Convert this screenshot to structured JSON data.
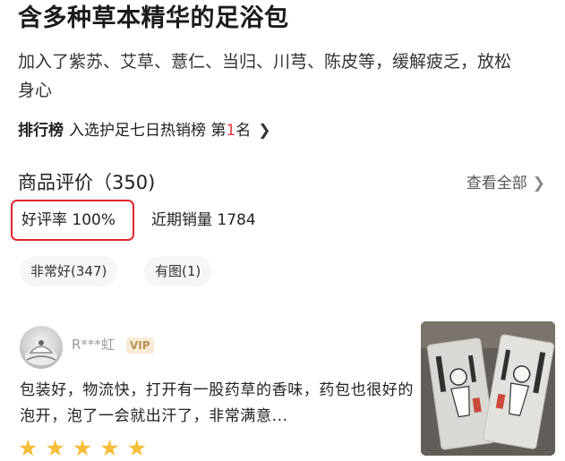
{
  "product": {
    "title": "含多种草本精华的足浴包",
    "description": "加入了紫苏、艾草、薏仁、当归、川芎、陈皮等，缓解疲乏，放松身心"
  },
  "ranking": {
    "tag": "排行榜",
    "text_prefix": "入选护足七日热销榜 第",
    "rank_number": "1",
    "text_suffix": "名",
    "chevron_icon": "chevron-right-icon"
  },
  "reviews": {
    "section_title": "商品评价（350)",
    "view_all_label": "查看全部",
    "good_rate": "好评率 100%",
    "recent_sales": "近期销量 1784",
    "highlight_color": "#e0262d",
    "filters": [
      "非常好(347)",
      "有图(1)"
    ],
    "items": [
      {
        "username": "R***虹",
        "badge": "VIP",
        "text": "包装好，物流快，打开有一股药草的香味，药包也很好的泡开，泡了一会就出汗了，非常满意...",
        "rating": 5,
        "star_glyph": "★★★★★",
        "star_color": "#f6bd3a",
        "photo_icon": "product-photo"
      }
    ]
  }
}
